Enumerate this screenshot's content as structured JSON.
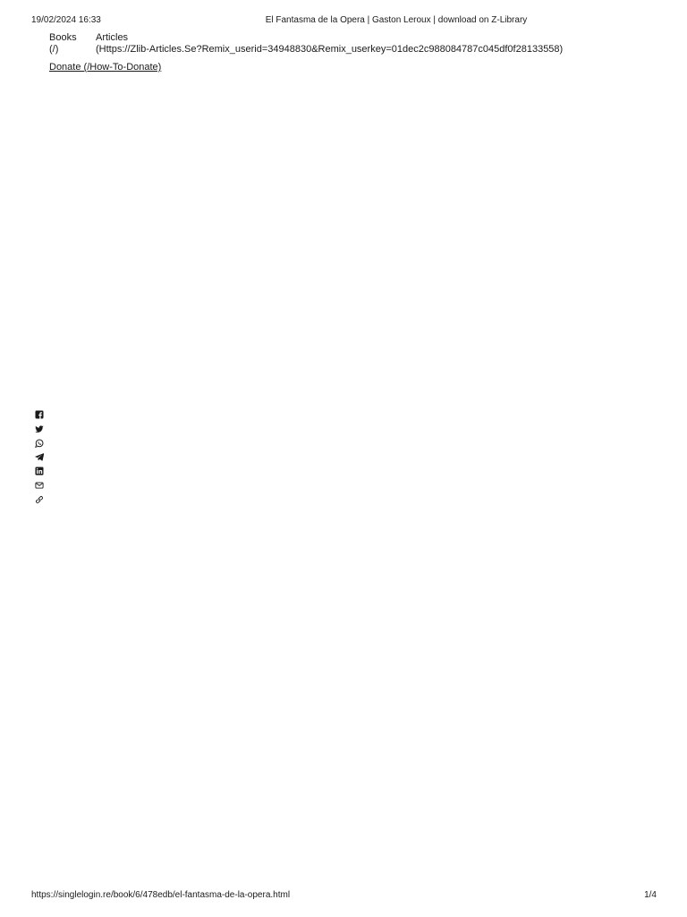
{
  "print_header": {
    "datetime": "19/02/2024 16:33",
    "title": "El Fantasma de la Opera | Gaston Leroux | download on Z-Library"
  },
  "nav": {
    "books_label": "Books",
    "books_href": "(/)",
    "articles_label": "Articles",
    "articles_href": "(Https://Zlib-Articles.Se?Remix_userid=34948830&Remix_userkey=01dec2c988084787c045df0f28133558)",
    "donate_label": "Donate (/How-To-Donate)"
  },
  "share_icons": [
    "facebook-icon",
    "twitter-icon",
    "whatsapp-icon",
    "telegram-icon",
    "linkedin-icon",
    "email-icon",
    "link-icon"
  ],
  "colors": {
    "text": "#1a1a1a",
    "background": "#ffffff"
  },
  "print_footer": {
    "url": "https://singlelogin.re/book/6/478edb/el-fantasma-de-la-opera.html",
    "page": "1/4"
  }
}
